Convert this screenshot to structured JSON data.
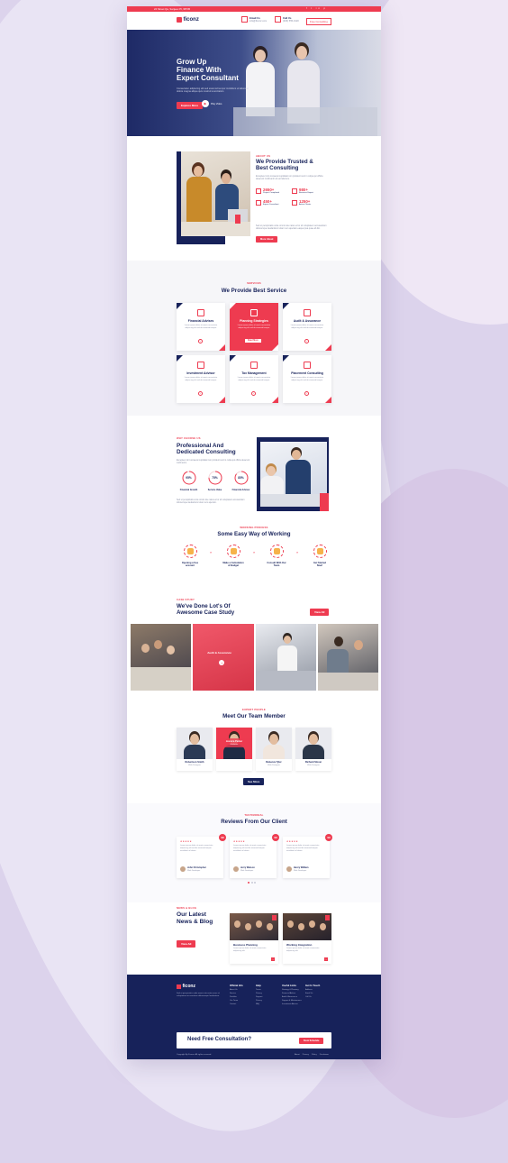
{
  "topbar": {
    "address": "24 Street Qa, Sanjeev Pl, 98745",
    "links": [
      "f",
      "t",
      "in",
      "p"
    ]
  },
  "header": {
    "brand": "ficonz",
    "email_label": "Email Us",
    "email_value": "info@ficonz.com",
    "call_label": "Call Us",
    "call_value": "(406) 555-0120",
    "cta": "Free Consulting"
  },
  "nav": {
    "items": [
      "HOME",
      "ABOUT US",
      "SERVICE",
      "PAGES",
      "BLOG",
      "CONTACT US"
    ]
  },
  "hero": {
    "title_line1": "Grow Up",
    "title_line2": "Finance With",
    "title_line3": "Expert Consultant",
    "text": "Consectetur adipiscing elit sed eiusmod tempor incididunt ut labore et dolore magna aliqua quis nostrud exercitation.",
    "btn": "Explore More",
    "video": "Play Video"
  },
  "about": {
    "label": "About Us",
    "title_line1": "We Provide Trusted &",
    "title_line2": "Best Consulting",
    "text": "Excepteur sint occaecat cupidatat non proident sunt in culpa qui officia deserunt mollit anim id est laborum.",
    "stats": [
      {
        "value": "2650+",
        "label": "Project Completed"
      },
      {
        "value": "980+",
        "label": "Business Expert"
      },
      {
        "value": "450+",
        "label": "Expert Consultant"
      },
      {
        "value": "1250+",
        "label": "Active Clients"
      }
    ],
    "text2": "Sed ut perspiciatis unde omnis iste natus error sit voluptatem accusantium doloremque laudantium totam rem aperiam eaque ipsa quae ab illo.",
    "btn": "More About"
  },
  "services": {
    "label": "Services",
    "title": "We Provide Best Service",
    "items": [
      {
        "name": "Financial Advises",
        "text": "Lorem ipsum dolor sit amet consectetur adipiscing elit sed do eiusmod tempor."
      },
      {
        "name": "Planning Strategies",
        "text": "Lorem ipsum dolor sit amet consectetur adipiscing elit sed do eiusmod tempor.",
        "btn": "Read More"
      },
      {
        "name": "Audit & Assurance",
        "text": "Lorem ipsum dolor sit amet consectetur adipiscing elit sed do eiusmod tempor."
      },
      {
        "name": "Investment Advisor",
        "text": "Lorem ipsum dolor sit amet consectetur adipiscing elit sed do eiusmod tempor."
      },
      {
        "name": "Tax Management",
        "text": "Lorem ipsum dolor sit amet consectetur adipiscing elit sed do eiusmod tempor."
      },
      {
        "name": "Placement Consulting",
        "text": "Lorem ipsum dolor sit amet consectetur adipiscing elit sed do eiusmod tempor."
      }
    ]
  },
  "why": {
    "label": "Why Choose Us",
    "title_line1": "Professional And",
    "title_line2": "Dedicated Consulting",
    "text": "Excepteur sint occaecat cupidatat non proident sunt in culpa qui officia deserunt mollit anim.",
    "circles": [
      {
        "value": "95%",
        "label": "Financial Growth",
        "pct": 0.95
      },
      {
        "value": "75%",
        "label": "Service Value",
        "pct": 0.75
      },
      {
        "value": "85%",
        "label": "Financial Advisor",
        "pct": 0.85
      }
    ],
    "text2": "Sed ut perspiciatis unde omnis iste natus error sit voluptatem accusantium doloremque laudantium totam rem aperiam."
  },
  "process": {
    "label": "Working Process",
    "title": "Some Easy Way of Working",
    "steps": [
      {
        "l1": "Opening a free",
        "l2": "account"
      },
      {
        "l1": "Make a Calculation",
        "l2": "of Budget"
      },
      {
        "l1": "Consult With Our",
        "l2": "Team"
      },
      {
        "l1": "Get Started",
        "l2": "Now!"
      }
    ]
  },
  "cases": {
    "label": "Case Study",
    "title_line1": "We've Done Lot's Of",
    "title_line2": "Awesome Case Study",
    "btn": "View All",
    "highlight": "Audit & Assurance"
  },
  "team": {
    "label": "Expert People",
    "title": "Meet Our Team Member",
    "members": [
      {
        "name": "Robertson Smith",
        "role": "Web Designer"
      },
      {
        "name": "Jessica Parker",
        "role": "Marketer"
      },
      {
        "name": "Rebecca Tyler",
        "role": "Web Designer"
      },
      {
        "name": "Richard Slover",
        "role": "Web Designer"
      }
    ],
    "btn": "See More"
  },
  "reviews": {
    "label": "Testimonial",
    "title": "Reviews From Our Client",
    "items": [
      {
        "name": "John Christopher",
        "role": "Web Developer",
        "stars": "★★★★★",
        "text": "Lorem ipsum dolor sit amet consectetur adipiscing elit sed do eiusmod tempor incididunt ut labore."
      },
      {
        "name": "Jerry Watson",
        "role": "Web Developer",
        "stars": "★★★★★",
        "text": "Lorem ipsum dolor sit amet consectetur adipiscing elit sed do eiusmod tempor incididunt ut labore."
      },
      {
        "name": "Henry William",
        "role": "Web Developer",
        "stars": "★★★★★",
        "text": "Lorem ipsum dolor sit amet consectetur adipiscing elit sed do eiusmod tempor incididunt ut labore."
      }
    ],
    "quote": "99"
  },
  "blog": {
    "label": "News & Blog",
    "title_line1": "Our Latest",
    "title_line2": "News & Blog",
    "btn": "View All",
    "posts": [
      {
        "title": "Business Planning",
        "text": "Lorem ipsum dolor sit amet consectetur adipiscing elit."
      },
      {
        "title": "Working Integration",
        "text": "Lorem ipsum dolor sit amet consectetur adipiscing elit."
      }
    ]
  },
  "footer": {
    "brand": "ficonz",
    "about": "Sed ut perspiciatis unde omnis iste natus error sit voluptatem accusantium doloremque laudantium.",
    "cols": [
      {
        "title": "Official Info",
        "items": [
          "About Us",
          "Service",
          "Portfolio",
          "Our Team",
          "Contact"
        ]
      },
      {
        "title": "Help",
        "items": [
          "Terms",
          "Privacy",
          "Support",
          "Privacy",
          "FAQ"
        ]
      },
      {
        "title": "Useful Links",
        "items": [
          "Strategy & Planning",
          "Financial Advice",
          "Audit & Assurance",
          "Support & Maintenance",
          "Investment Advisor"
        ]
      },
      {
        "title": "Get In Touch",
        "items": [
          "Address",
          "Email Us",
          "Call Us"
        ]
      }
    ],
    "cta_title": "Need Free Consultation?",
    "cta_btn": "Book Schedule",
    "copyright": "Copyright By Ficonz. All rights reserved.",
    "bottom_links": [
      "About",
      "Privacy",
      "Policy",
      "Disclaimer"
    ]
  },
  "colors": {
    "accent": "#ee3b50",
    "navy": "#17225a"
  }
}
